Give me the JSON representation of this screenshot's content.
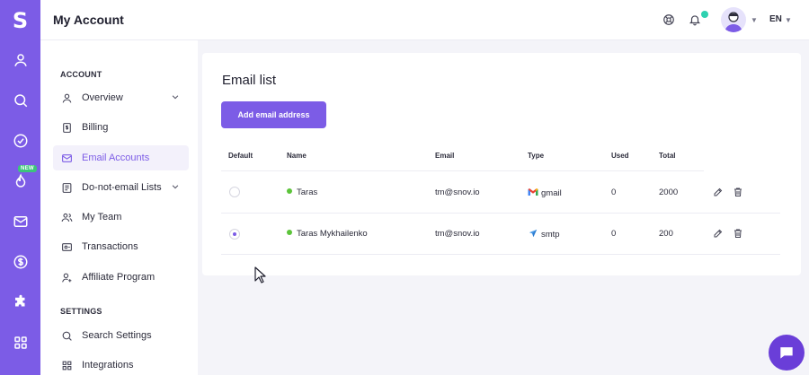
{
  "app": {
    "logo_letter": "S",
    "page_title": "My Account",
    "language": "EN",
    "new_badge": "NEW",
    "accent_color": "#7c5ce6"
  },
  "rail_icons": [
    "user-icon",
    "search-icon",
    "check-circle-icon",
    "flame-icon",
    "mail-icon",
    "dollar-icon",
    "puzzle-icon",
    "apps-grid-icon"
  ],
  "header_icons": [
    "support-lifebuoy-icon",
    "bell-icon",
    "avatar",
    "chevron-down-icon"
  ],
  "sidebar": {
    "account_title": "ACCOUNT",
    "settings_title": "SETTINGS",
    "account_items": [
      {
        "label": "Overview",
        "icon": "user-icon",
        "expandable": true
      },
      {
        "label": "Billing",
        "icon": "billing-icon",
        "expandable": false
      },
      {
        "label": "Email Accounts",
        "icon": "mail-icon",
        "expandable": false,
        "active": true
      },
      {
        "label": "Do-not-email Lists",
        "icon": "list-icon",
        "expandable": true
      },
      {
        "label": "My Team",
        "icon": "team-icon",
        "expandable": false
      },
      {
        "label": "Transactions",
        "icon": "wallet-icon",
        "expandable": false
      },
      {
        "label": "Affiliate Program",
        "icon": "user-plus-icon",
        "expandable": false
      }
    ],
    "settings_items": [
      {
        "label": "Search Settings",
        "icon": "search-icon"
      },
      {
        "label": "Integrations",
        "icon": "integrations-icon"
      }
    ]
  },
  "main": {
    "heading": "Email list",
    "add_button": "Add email address",
    "columns": [
      "Default",
      "Name",
      "Email",
      "Type",
      "Used",
      "Total"
    ],
    "rows": [
      {
        "default": false,
        "name": "Taras",
        "email": "tm@snov.io",
        "type": "gmail",
        "type_icon": "gmail-icon",
        "used": "0",
        "total": "2000"
      },
      {
        "default": true,
        "name": "Taras Mykhailenko",
        "email": "tm@snov.io",
        "type": "smtp",
        "type_icon": "send-plane-icon",
        "used": "0",
        "total": "200"
      }
    ]
  }
}
